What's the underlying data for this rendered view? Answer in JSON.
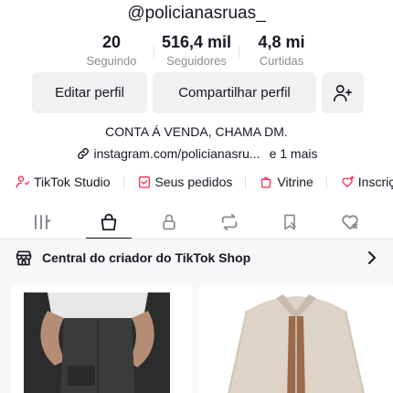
{
  "profile": {
    "username": "@policianasruas_",
    "bio": "CONTA Á VENDA, CHAMA DM.",
    "link": "instagram.com/policianasru...",
    "link_more": "e 1 mais"
  },
  "stats": [
    {
      "value": "20",
      "label": "Seguindo"
    },
    {
      "value": "516,4 mil",
      "label": "Seguidores"
    },
    {
      "value": "4,8 mi",
      "label": "Curtidas"
    }
  ],
  "actions": {
    "edit_label": "Editar perfil",
    "share_label": "Compartilhar perfil",
    "add_friend_icon": "add-user-icon"
  },
  "shortcuts": [
    {
      "label": "TikTok Studio",
      "icon": "studio-icon"
    },
    {
      "label": "Seus pedidos",
      "icon": "orders-icon"
    },
    {
      "label": "Vitrine",
      "icon": "bag-icon"
    },
    {
      "label": "Inscriçã",
      "icon": "subscription-icon"
    }
  ],
  "tabs": [
    {
      "icon": "grid-icon"
    },
    {
      "icon": "shop-bag-icon",
      "active": true
    },
    {
      "icon": "lock-icon"
    },
    {
      "icon": "repost-icon"
    },
    {
      "icon": "bookmark-icon"
    },
    {
      "icon": "liked-icon"
    }
  ],
  "shop_banner": {
    "label": "Central do criador do TikTok Shop"
  },
  "colors": {
    "text": "#161823",
    "muted": "#8a8b91",
    "button_bg": "#f1f1f2",
    "accent": "#fe2c55"
  }
}
